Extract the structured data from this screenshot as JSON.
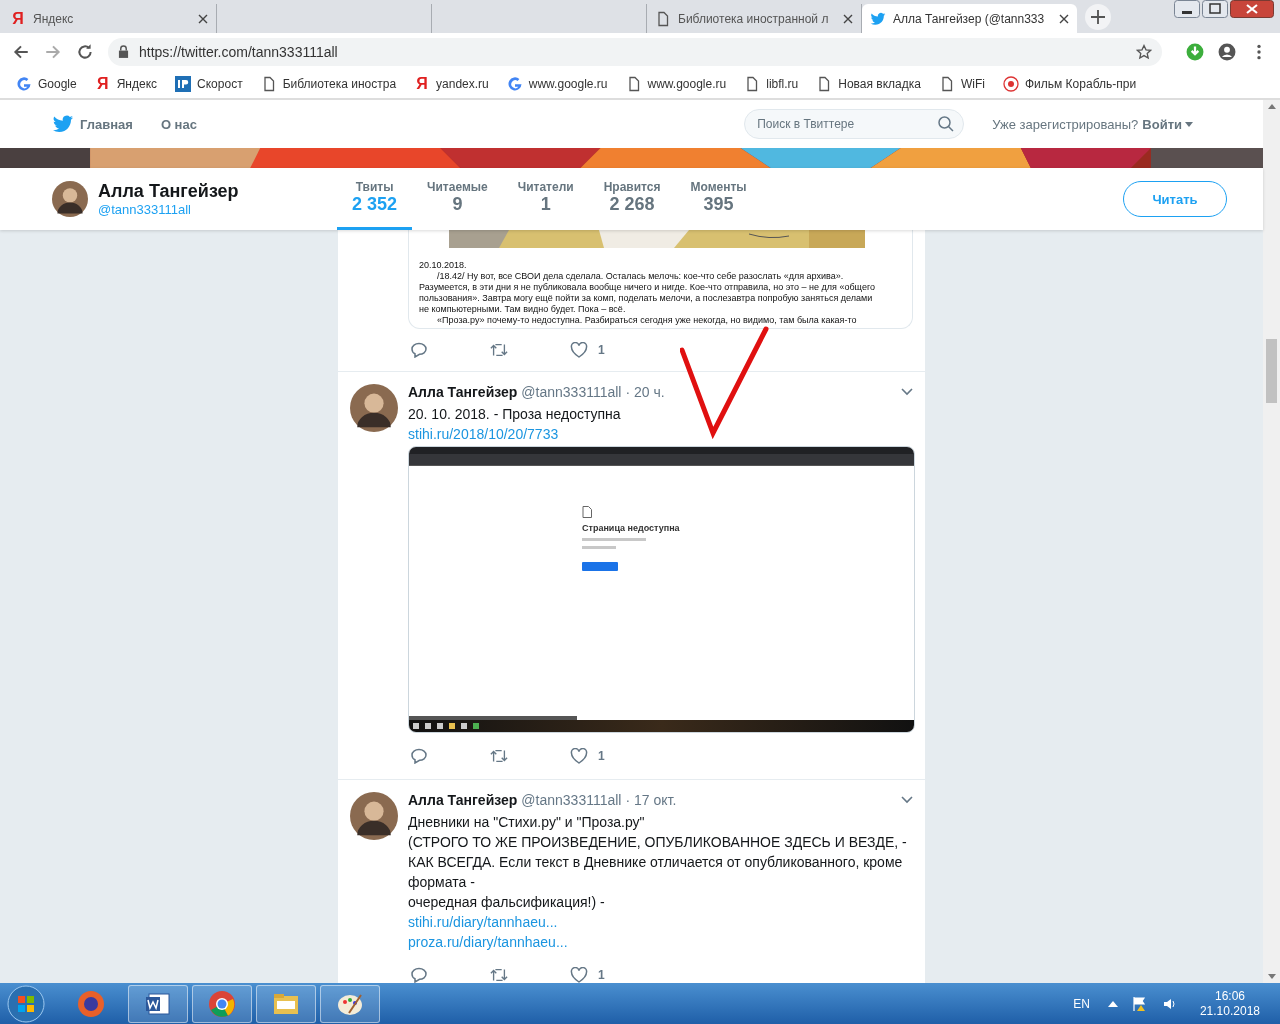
{
  "browser": {
    "tabs": [
      {
        "title": "Яндекс",
        "kind": "yandex",
        "glyph": "Я",
        "selected": false
      },
      {
        "kind": "blank",
        "selected": false
      },
      {
        "kind": "blank",
        "selected": false
      },
      {
        "title": "Библиотека иностранной л",
        "kind": "page",
        "selected": false
      },
      {
        "title": "Алла Тангейзер (@tann333",
        "kind": "twitter",
        "selected": true
      }
    ],
    "url": "https://twitter.com/tann333111all",
    "bookmarks": [
      {
        "label": "Google",
        "kind": "google"
      },
      {
        "label": "Яндекс",
        "kind": "yandex",
        "glyph": "Я"
      },
      {
        "label": "Скорост",
        "kind": "ip"
      },
      {
        "label": "Библиотека иностра",
        "kind": "page"
      },
      {
        "label": "yandex.ru",
        "kind": "yandex",
        "glyph": "Я"
      },
      {
        "label": "www.google.ru",
        "kind": "google"
      },
      {
        "label": "www.google.ru",
        "kind": "page"
      },
      {
        "label": "libfl.ru",
        "kind": "page"
      },
      {
        "label": "Новая вкладка",
        "kind": "page"
      },
      {
        "label": "WiFi",
        "kind": "page"
      },
      {
        "label": "Фильм Корабль-при",
        "kind": "hd"
      }
    ]
  },
  "nav": {
    "items": [
      "Главная",
      "О нас"
    ],
    "search": {
      "placeholder": "Поиск в Твиттере"
    },
    "login_prompt": "Уже зарегистрированы?",
    "login": "Войти"
  },
  "profile": {
    "name": "Алла Тангейзер",
    "handle": "@tann333111all",
    "stats": [
      {
        "label": "Твиты",
        "value": "2 352",
        "selected": true
      },
      {
        "label": "Читаемые",
        "value": "9",
        "selected": false
      },
      {
        "label": "Читатели",
        "value": "1",
        "selected": false
      },
      {
        "label": "Нравится",
        "value": "2 268",
        "selected": false
      },
      {
        "label": "Моменты",
        "value": "395",
        "selected": false
      }
    ],
    "follow": "Читать"
  },
  "tweets": [
    {
      "kind": "document",
      "document_lines": [
        "20.10.2018.",
        "/18.42/ Ну вот, все СВОИ дела сделала. Осталась мелочь: кое-что себе разослать «для архива».",
        "Разумеется, в эти дни я не публиковала вообще ничего и нигде. Кое-что отправила, но это – не для «общего",
        "пользования». Завтра могу ещё пойти за комп, поделать мелочи, а послезавтра попробую заняться делами",
        "не компьютерными. Там видно будет. Пока – всё.",
        "«Проза.ру» почему-то недоступна. Разбираться сегодня уже некогда, но видимо, там была какая-то"
      ],
      "likes": "1"
    },
    {
      "kind": "screenshot",
      "name": "Алла Тангейзер",
      "handle": "@tann333111all",
      "time": "· 20 ч.",
      "lines": [
        "20. 10. 2018. - Проза недоступна"
      ],
      "links": [
        "stihi.ru/2018/10/20/7733"
      ],
      "shot_title": "Страница недоступна",
      "likes": "1"
    },
    {
      "kind": "text",
      "name": "Алла Тангейзер",
      "handle": "@tann333111all",
      "time": "· 17 окт.",
      "lines": [
        "Дневники на \"Стихи.ру\" и \"Проза.ру\"",
        "(СТРОГО ТО ЖЕ ПРОИЗВЕДЕНИЕ, ОПУБЛИКОВАННОЕ ЗДЕСЬ И ВЕЗДЕ, -",
        "КАК ВСЕГДА. Если текст в Дневнике отличается от опубликованного, кроме",
        "формата -",
        "очередная фальсификация!) -"
      ],
      "links": [
        "stihi.ru/diary/tannhaeu...",
        "proza.ru/diary/tannhaeu..."
      ],
      "likes": "1"
    }
  ],
  "taskbar": {
    "language": "EN",
    "time": "16:06",
    "date": "21.10.2018"
  }
}
